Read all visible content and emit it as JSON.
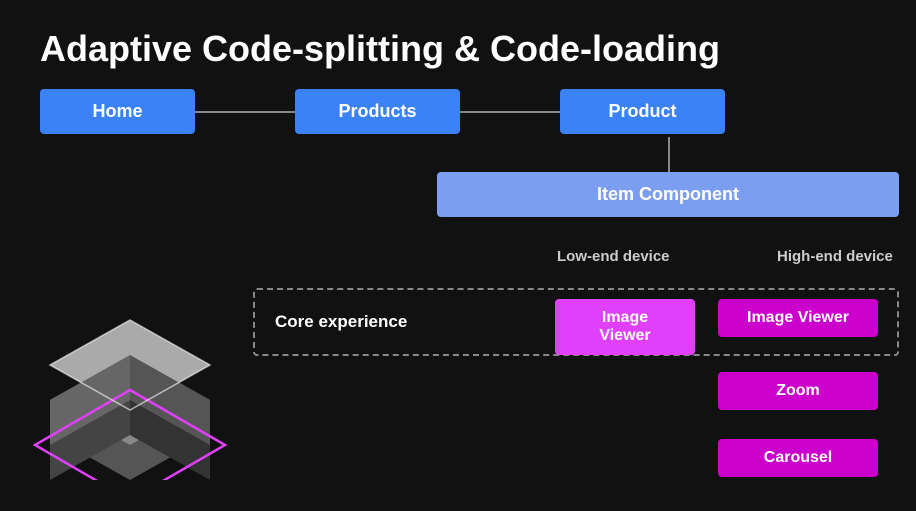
{
  "title": "Adaptive Code-splitting & Code-loading",
  "nav": {
    "home_label": "Home",
    "products_label": "Products",
    "product_label": "Product"
  },
  "item_component_label": "Item Component",
  "device_labels": {
    "low_end": "Low-end device",
    "high_end": "High-end device"
  },
  "core_experience_label": "Core experience",
  "image_viewer_label": "Image Viewer",
  "zoom_label": "Zoom",
  "carousel_label": "Carousel",
  "colors": {
    "nav_blue": "#3b82f6",
    "item_blue": "#7c9ef0",
    "image_viewer_low": "#e040fb",
    "image_viewer_high": "#cc00cc",
    "zoom": "#cc00cc",
    "carousel": "#cc00cc"
  }
}
